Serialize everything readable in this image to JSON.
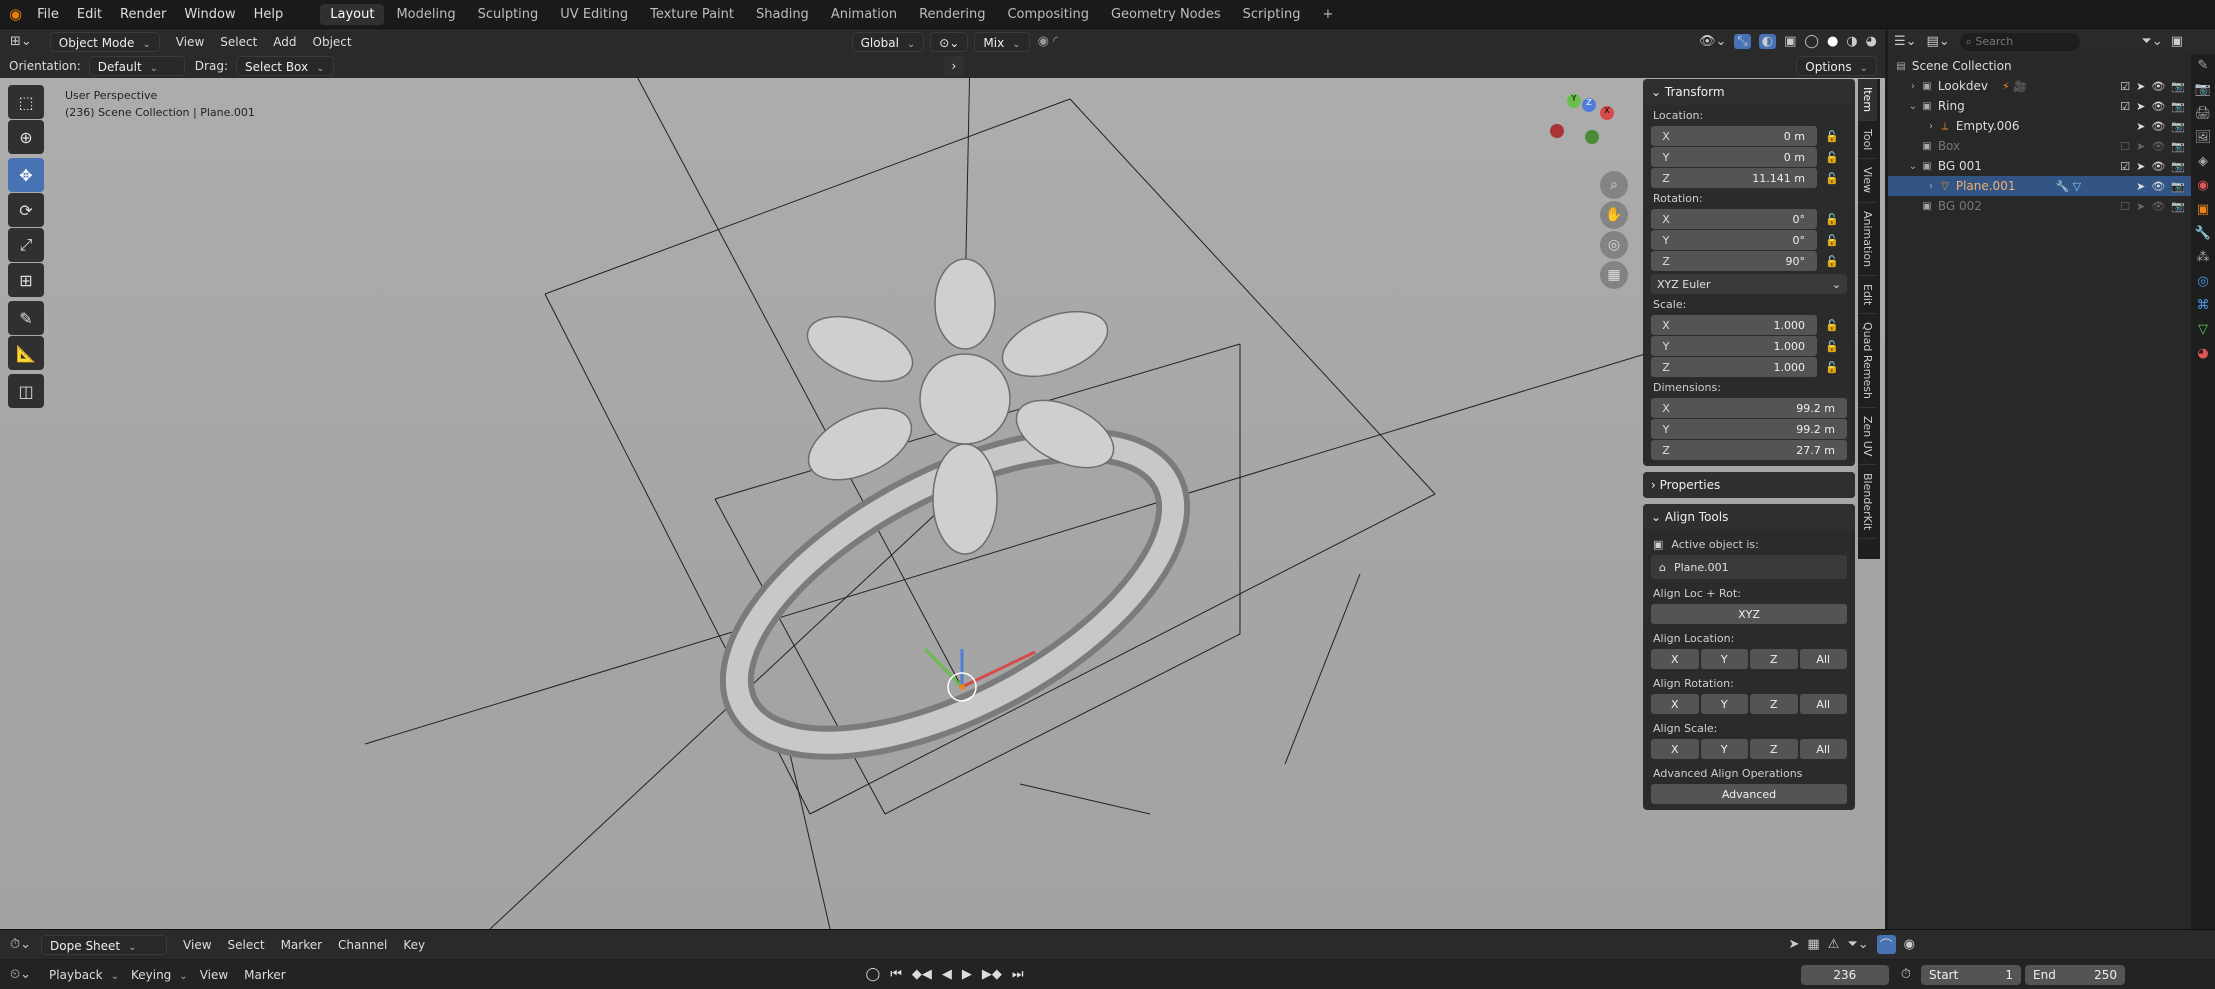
{
  "menu": [
    "File",
    "Edit",
    "Render",
    "Window",
    "Help"
  ],
  "workspaces": [
    "Layout",
    "Modeling",
    "Sculpting",
    "UV Editing",
    "Texture Paint",
    "Shading",
    "Animation",
    "Rendering",
    "Compositing",
    "Geometry Nodes",
    "Scripting"
  ],
  "header": {
    "mode": "Object Mode",
    "view": "View",
    "select": "Select",
    "add": "Add",
    "object": "Object",
    "transform_orient": "Global",
    "pivot_mix": "Mix"
  },
  "tools_row": {
    "orientation_label": "Orientation:",
    "orientation": "Default",
    "drag_label": "Drag:",
    "drag": "Select Box",
    "options": "Options"
  },
  "viewport": {
    "perspective": "User Perspective",
    "collection": "(236) Scene Collection | Plane.001"
  },
  "transform": {
    "title": "Transform",
    "location_label": "Location:",
    "location": [
      {
        "k": "X",
        "v": "0 m"
      },
      {
        "k": "Y",
        "v": "0 m"
      },
      {
        "k": "Z",
        "v": "11.141 m"
      }
    ],
    "rotation_label": "Rotation:",
    "rotation": [
      {
        "k": "X",
        "v": "0°"
      },
      {
        "k": "Y",
        "v": "0°"
      },
      {
        "k": "Z",
        "v": "90°"
      }
    ],
    "rotation_mode": "XYZ Euler",
    "scale_label": "Scale:",
    "scale": [
      {
        "k": "X",
        "v": "1.000"
      },
      {
        "k": "Y",
        "v": "1.000"
      },
      {
        "k": "Z",
        "v": "1.000"
      }
    ],
    "dimensions_label": "Dimensions:",
    "dimensions": [
      {
        "k": "X",
        "v": "99.2 m"
      },
      {
        "k": "Y",
        "v": "99.2 m"
      },
      {
        "k": "Z",
        "v": "27.7 m"
      }
    ]
  },
  "properties": {
    "title": "Properties"
  },
  "align": {
    "title": "Align Tools",
    "active_label": "Active object is:",
    "active_object": "Plane.001",
    "locrot_label": "Align Loc + Rot:",
    "locrot_btn": "XYZ",
    "loc_label": "Align Location:",
    "rot_label": "Align Rotation:",
    "scale_label": "Align Scale:",
    "axes": [
      "X",
      "Y",
      "Z",
      "All"
    ],
    "adv_label": "Advanced Align Operations",
    "adv_btn": "Advanced"
  },
  "side_tabs": [
    "Item",
    "Tool",
    "View",
    "Animation",
    "Edit",
    "Quad Remesh",
    "Zen UV",
    "BlenderKit"
  ],
  "outliner": {
    "search_placeholder": "Search",
    "root": "Scene Collection",
    "items": [
      {
        "name": "Lookdev",
        "indent": 1
      },
      {
        "name": "Ring",
        "indent": 1
      },
      {
        "name": "Empty.006",
        "indent": 2
      },
      {
        "name": "Box",
        "indent": 1
      },
      {
        "name": "BG 001",
        "indent": 1
      },
      {
        "name": "Plane.001",
        "indent": 2
      },
      {
        "name": "BG 002",
        "indent": 1
      }
    ]
  },
  "dopesheet": {
    "editor": "Dope Sheet",
    "view": "View",
    "select": "Select",
    "marker": "Marker",
    "channel": "Channel",
    "key": "Key"
  },
  "timeline": {
    "playback": "Playback",
    "keying": "Keying",
    "view": "View",
    "marker": "Marker",
    "frame": "236",
    "start_label": "Start",
    "start": "1",
    "end_label": "End",
    "end": "250"
  }
}
